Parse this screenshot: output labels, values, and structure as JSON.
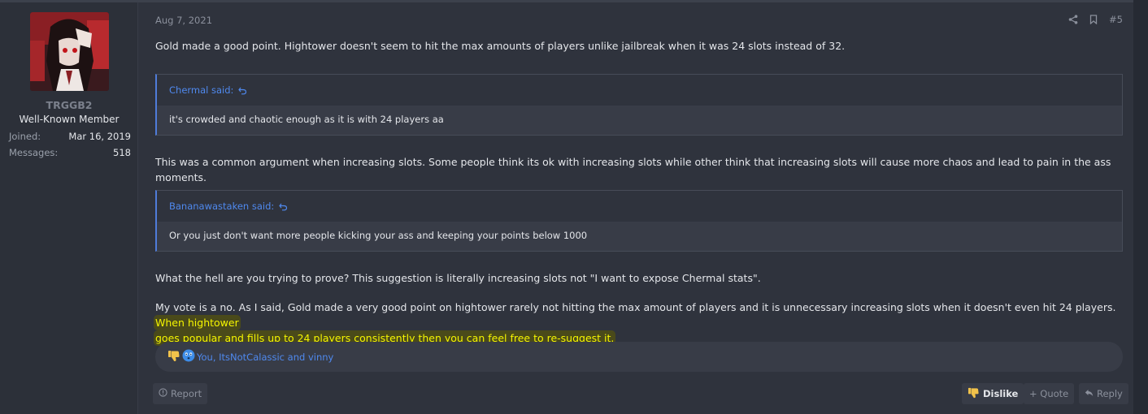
{
  "user": {
    "username": "TRGGB2",
    "title": "Well-Known Member",
    "joined_label": "Joined:",
    "joined_value": "Mar 16, 2019",
    "messages_label": "Messages:",
    "messages_value": "518"
  },
  "post": {
    "date": "Aug 7, 2021",
    "number": "#5",
    "paragraph1": "Gold made a good point. Hightower doesn't seem to hit the max amounts of players unlike jailbreak when it was 24 slots instead of 32.",
    "quote1": {
      "author": "Chermal said:",
      "text": "it's crowded and chaotic enough as it is with 24 players aa"
    },
    "paragraph2": "This was a common argument when increasing slots. Some people think its ok with increasing slots while other think that increasing slots will cause more chaos and lead to pain in the ass moments.",
    "quote2": {
      "author": "Bananawastaken said:",
      "text": "Or you just don't want more people kicking your ass and keeping your points below 1000"
    },
    "paragraph3": "What the hell are you trying to prove? This suggestion is literally increasing slots not \"I want to expose Chermal stats\".",
    "paragraph4_line1": "My vote is a no. As I said, Gold made a very good point on hightower rarely not hitting the max amount of players and it is unnecessary increasing slots when it doesn't even hit 24 players.",
    "paragraph4_highlight1": "When hightower",
    "paragraph4_highlight2": "goes popular and fills up to 24 players consistently then you can feel free to re-suggest it."
  },
  "reactions": {
    "text": "You, ItsNotCalassic and vinny"
  },
  "footer": {
    "report": "Report",
    "dislike": "Dislike",
    "quote": "+ Quote",
    "reply": "Reply"
  },
  "colors": {
    "background": "#2f333d",
    "link": "#4f89ee",
    "highlight_text": "#f5f500",
    "quote_bar": "#4f7cd9"
  },
  "icons": [
    "share-icon",
    "bookmark-icon",
    "reply-arrow-icon",
    "thumbs-down-icon",
    "smiley-icon",
    "report-icon",
    "reply-icon"
  ]
}
